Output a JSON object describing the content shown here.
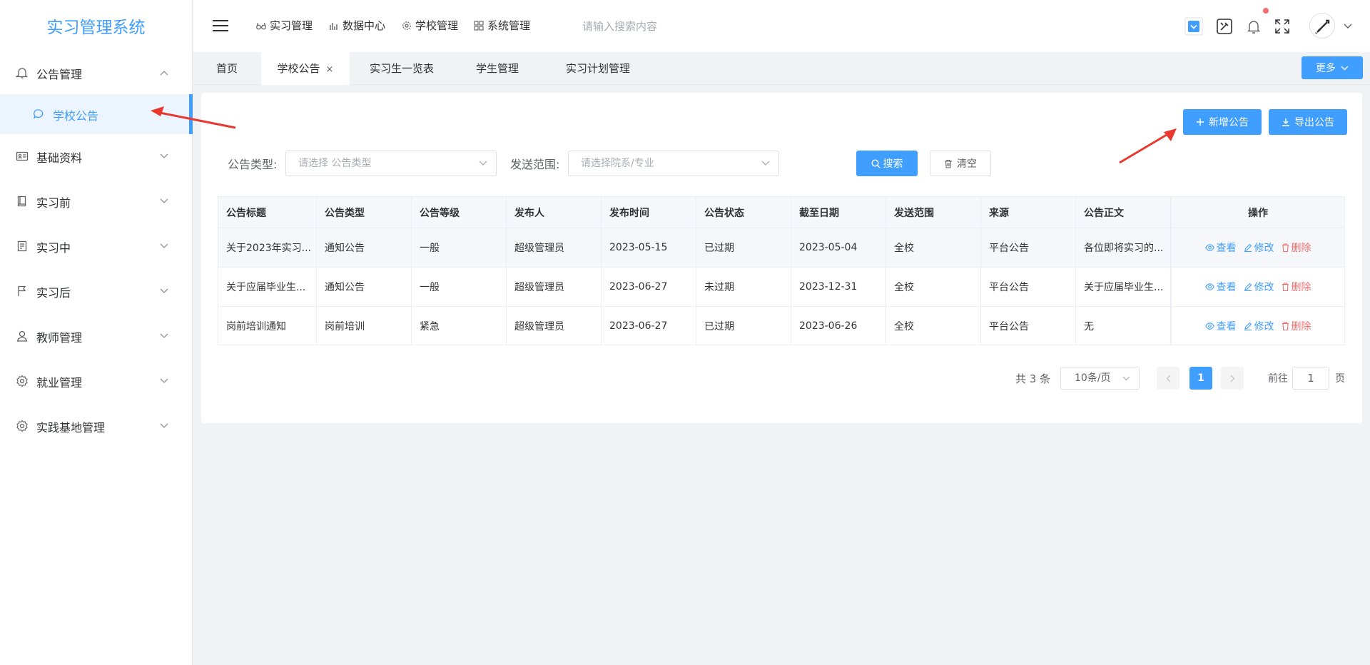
{
  "app": {
    "title": "实习管理系统"
  },
  "sidebar": {
    "groups": [
      {
        "label": "公告管理",
        "icon": "bell-icon",
        "expanded": true
      },
      {
        "label": "基础资料",
        "icon": "id-card-icon"
      },
      {
        "label": "实习前",
        "icon": "book-icon"
      },
      {
        "label": "实习中",
        "icon": "document-icon"
      },
      {
        "label": "实习后",
        "icon": "flag-icon"
      },
      {
        "label": "教师管理",
        "icon": "user-icon"
      },
      {
        "label": "就业管理",
        "icon": "gear-icon"
      },
      {
        "label": "实践基地管理",
        "icon": "gear-icon"
      }
    ],
    "active_sub": {
      "label": "学校公告",
      "icon": "chat-bubble-icon"
    }
  },
  "header": {
    "nav": [
      {
        "label": "实习管理",
        "icon": "glasses-icon"
      },
      {
        "label": "数据中心",
        "icon": "bar-chart-icon"
      },
      {
        "label": "学校管理",
        "icon": "gear-icon"
      },
      {
        "label": "系统管理",
        "icon": "grid-icon"
      }
    ],
    "search_placeholder": "请输入搜索内容"
  },
  "tabs": {
    "items": [
      {
        "label": "首页"
      },
      {
        "label": "学校公告",
        "active": true,
        "close": "×"
      },
      {
        "label": "实习生一览表"
      },
      {
        "label": "学生管理"
      },
      {
        "label": "实习计划管理"
      }
    ],
    "more_label": "更多"
  },
  "toolbar": {
    "add_label": "新增公告",
    "export_label": "导出公告"
  },
  "filters": {
    "type_label": "公告类型:",
    "type_placeholder": "请选择 公告类型",
    "scope_label": "发送范围:",
    "scope_placeholder": "请选择院系/专业",
    "search_label": "搜索",
    "clear_label": "清空"
  },
  "table": {
    "columns": [
      "公告标题",
      "公告类型",
      "公告等级",
      "发布人",
      "发布时间",
      "公告状态",
      "截至日期",
      "发送范围",
      "来源",
      "公告正文",
      "操作"
    ],
    "rows": [
      [
        "关于2023年实习...",
        "通知公告",
        "一般",
        "超级管理员",
        "2023-05-15",
        "已过期",
        "2023-05-04",
        "全校",
        "平台公告",
        "各位即将实习的..."
      ],
      [
        "关于应届毕业生...",
        "通知公告",
        "一般",
        "超级管理员",
        "2023-06-27",
        "未过期",
        "2023-12-31",
        "全校",
        "平台公告",
        "关于应届毕业生..."
      ],
      [
        "岗前培训通知",
        "岗前培训",
        "紧急",
        "超级管理员",
        "2023-06-27",
        "已过期",
        "2023-06-26",
        "全校",
        "平台公告",
        "无"
      ]
    ],
    "actions": {
      "view": "查看",
      "edit": "修改",
      "delete": "删除"
    }
  },
  "pagination": {
    "total_text": "共 3 条",
    "page_size": "10条/页",
    "current_page": "1",
    "goto_label": "前往",
    "goto_value": "1",
    "page_suffix": "页"
  },
  "colors": {
    "accent": "#409eff",
    "danger": "#f56c6c",
    "annotation": "#e8382f"
  }
}
